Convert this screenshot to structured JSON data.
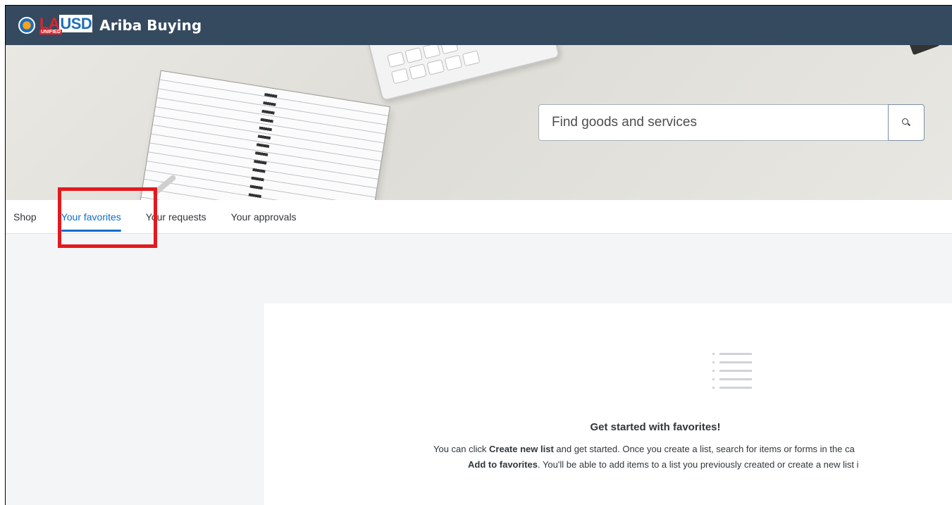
{
  "header": {
    "logo_text": "LAUSD",
    "logo_subtext": "UNIFIED",
    "app_title": "Ariba Buying"
  },
  "search": {
    "placeholder": "Find goods and services",
    "button_icon": "search-icon"
  },
  "tabs": [
    {
      "label": "Shop",
      "active": false
    },
    {
      "label": "Your favorites",
      "active": true
    },
    {
      "label": "Your requests",
      "active": false
    },
    {
      "label": "Your approvals",
      "active": false
    }
  ],
  "empty_state": {
    "icon": "list-icon",
    "title": "Get started with favorites!",
    "line1_pre": "You can click ",
    "line1_bold": "Create new list",
    "line1_post": " and get started. Once you create a list, search for items or forms in the ca",
    "line2_bold": "Add to favorites",
    "line2_post": ". You'll be able to add items to a list you previously created or create a new list i"
  },
  "colors": {
    "header_bg": "#354a5f",
    "accent": "#0a6ed1",
    "highlight": "#e3191f"
  }
}
